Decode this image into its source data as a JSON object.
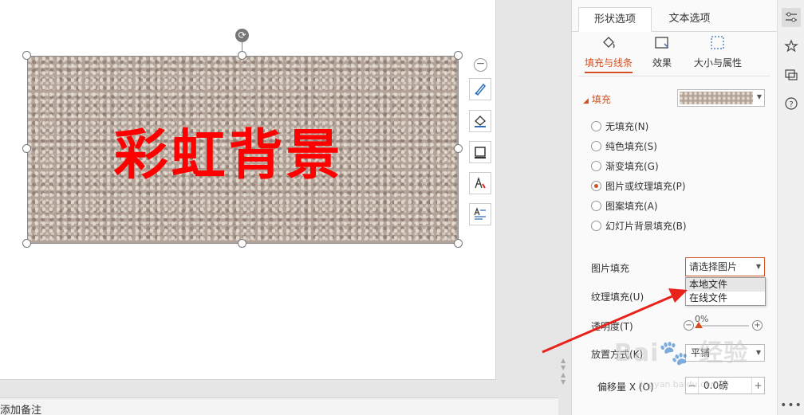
{
  "slide": {
    "shape_text": "彩虹背景",
    "shape_text_color": "#ff0000"
  },
  "notes": {
    "placeholder": "添加备注"
  },
  "panel": {
    "tabs": [
      {
        "label": "形状选项",
        "active": true
      },
      {
        "label": "文本选项",
        "active": false
      }
    ],
    "subtabs": [
      {
        "label": "填充与线条",
        "icon": "fill-bucket-icon",
        "active": true
      },
      {
        "label": "效果",
        "icon": "effects-icon",
        "active": false
      },
      {
        "label": "大小与属性",
        "icon": "size-properties-icon",
        "active": false
      }
    ],
    "fill_section": {
      "title": "填充",
      "options": [
        {
          "label": "无填充(N)",
          "checked": false
        },
        {
          "label": "纯色填充(S)",
          "checked": false
        },
        {
          "label": "渐变填充(G)",
          "checked": false
        },
        {
          "label": "图片或纹理填充(P)",
          "checked": true
        },
        {
          "label": "图案填充(A)",
          "checked": false
        },
        {
          "label": "幻灯片背景填充(B)",
          "checked": false
        }
      ]
    },
    "picture_fill": {
      "label": "图片填充",
      "value": "请选择图片",
      "dropdown": [
        "本地文件",
        "在线文件"
      ]
    },
    "texture_fill": {
      "label": "纹理填充(U)"
    },
    "transparency": {
      "label": "透明度(T)",
      "value": "0%",
      "level": 0
    },
    "placement": {
      "label": "放置方式(K)",
      "value": "平铺"
    },
    "offset_x": {
      "label": "偏移量 X (O)",
      "value": "0.0磅"
    }
  },
  "colors": {
    "accent": "#d2501f",
    "annotation_arrow": "#e8231b"
  },
  "watermark": {
    "logo": "Baidu经验",
    "url": "jingyan.baidu.com"
  }
}
